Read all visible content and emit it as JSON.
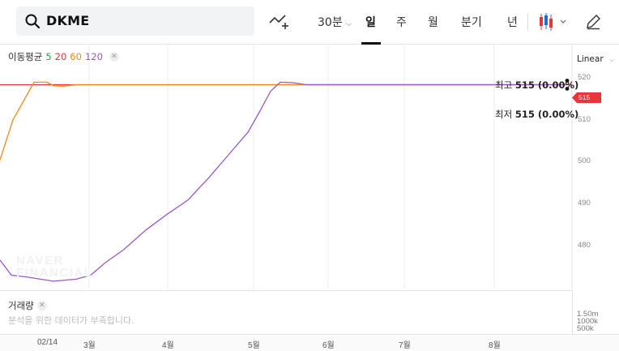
{
  "search": {
    "value": "DKME",
    "icon": "search-icon"
  },
  "toolbar": {
    "interval_label": "30분",
    "periods": [
      "일",
      "주",
      "월",
      "분기",
      "년"
    ],
    "active_period": "일"
  },
  "ma_legend": {
    "label": "이동평균",
    "periods": [
      {
        "label": "5",
        "color": "#27a844"
      },
      {
        "label": "20",
        "color": "#e8353b"
      },
      {
        "label": "60",
        "color": "#f08a1c"
      },
      {
        "label": "120",
        "color": "#9b59c9"
      }
    ]
  },
  "scale_mode": "Linear",
  "price_axis": [
    "520",
    "510",
    "500",
    "490",
    "480"
  ],
  "current_price": "515",
  "high": {
    "prefix": "최고",
    "value": "515 (0.00%)"
  },
  "low": {
    "prefix": "최저",
    "value": "515 (0.00%)"
  },
  "watermark": [
    "NAVER",
    "FINANCIAL"
  ],
  "volume": {
    "title": "거래량",
    "message": "분석을 위한 데이터가 부족합니다.",
    "axis": [
      "1.50m",
      "1000k",
      "500k"
    ]
  },
  "x_axis": [
    "02/14",
    "3월",
    "4월",
    "5월",
    "6월",
    "7월",
    "8월"
  ],
  "colors": {
    "price_line": "#e8353b",
    "ma60": "#f08a1c",
    "ma120": "#9b59c9",
    "grid": "#ececec"
  },
  "chart_data": {
    "type": "line",
    "title": "",
    "xlabel": "",
    "ylabel": "",
    "ylim": [
      474,
      523
    ],
    "x_ticks": [
      "02/14",
      "3월",
      "4월",
      "5월",
      "6월",
      "7월",
      "8월"
    ],
    "series": [
      {
        "name": "20",
        "color": "#e8353b",
        "values": [
          515,
          515
        ]
      },
      {
        "name": "60",
        "color": "#f08a1c",
        "values": [
          500,
          508,
          512,
          515.5,
          515.5,
          514.8,
          514.7,
          514.9,
          515,
          515,
          515
        ]
      },
      {
        "name": "120",
        "color": "#9b59c9",
        "values": [
          480,
          477,
          476.6,
          475.8,
          476.2,
          477,
          479.5,
          482,
          486,
          489,
          492,
          496.5,
          501,
          505.5,
          509.5,
          513.7,
          515.5,
          515.4,
          515,
          515,
          515,
          515
        ]
      }
    ]
  }
}
